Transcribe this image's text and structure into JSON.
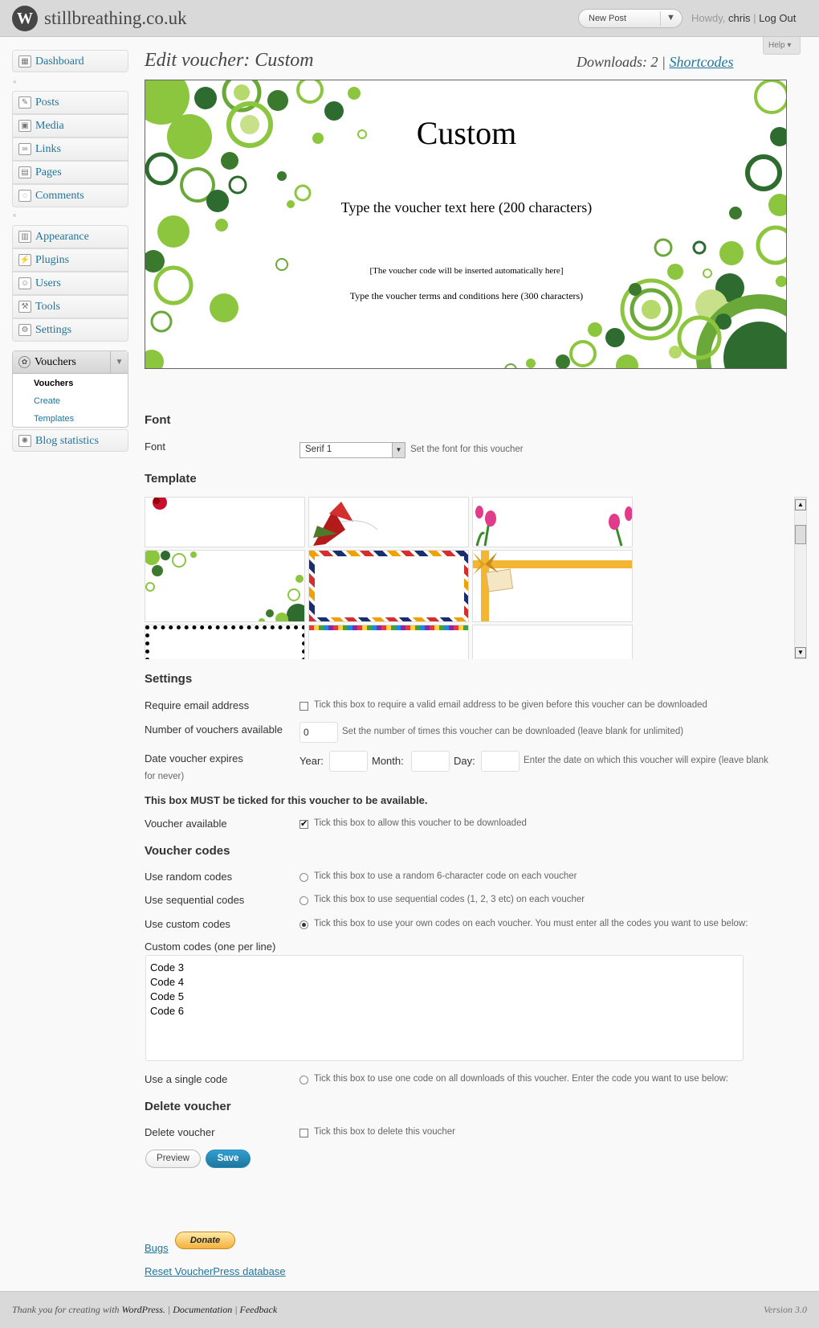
{
  "header": {
    "site_name": "stillbreathing.co.uk",
    "new_post": "New Post",
    "howdy": "Howdy,",
    "user": "chris",
    "logout": "Log Out",
    "help": "Help"
  },
  "sidebar": {
    "items": [
      {
        "label": "Dashboard",
        "icon": "dashboard-icon"
      },
      {
        "label": "Posts",
        "icon": "pin-icon"
      },
      {
        "label": "Media",
        "icon": "media-icon"
      },
      {
        "label": "Links",
        "icon": "link-icon"
      },
      {
        "label": "Pages",
        "icon": "page-icon"
      },
      {
        "label": "Comments",
        "icon": "comment-icon"
      },
      {
        "label": "Appearance",
        "icon": "appearance-icon"
      },
      {
        "label": "Plugins",
        "icon": "plugin-icon"
      },
      {
        "label": "Users",
        "icon": "users-icon"
      },
      {
        "label": "Tools",
        "icon": "tools-icon"
      },
      {
        "label": "Settings",
        "icon": "settings-icon"
      }
    ],
    "vouchers": {
      "label": "Vouchers",
      "sub": [
        "Vouchers",
        "Create",
        "Templates"
      ]
    },
    "blog_stats": "Blog statistics"
  },
  "main": {
    "title": "Edit voucher: Custom",
    "downloads_label": "Downloads:",
    "downloads_count": "2",
    "shortcodes": "Shortcodes",
    "preview": {
      "title": "Custom",
      "text": "Type the voucher text here (200 characters)",
      "code": "[The voucher code will be inserted automatically here]",
      "terms": "Type the voucher terms and conditions here (300 characters)"
    },
    "font_section": "Font",
    "font_label": "Font",
    "font_value": "Serif 1",
    "font_desc": "Set the font for this voucher",
    "template_section": "Template",
    "settings_section": "Settings",
    "require_email_label": "Require email address",
    "require_email_desc": "Tick this box to require a valid email address to be given before this voucher can be downloaded",
    "num_vouchers_label": "Number of vouchers available",
    "num_vouchers_value": "0",
    "num_vouchers_desc": "Set the number of times this voucher can be downloaded (leave blank for unlimited)",
    "expires_label": "Date voucher expires",
    "year_label": "Year:",
    "month_label": "Month:",
    "day_label": "Day:",
    "expires_desc_1": "Enter the date on which this voucher will expire (leave blank",
    "expires_desc_2": "for never)",
    "must_tick": "This box MUST be ticked for this voucher to be available.",
    "available_label": "Voucher available",
    "available_desc": "Tick this box to allow this voucher to be downloaded",
    "codes_section": "Voucher codes",
    "random_label": "Use random codes",
    "random_desc": "Tick this box to use a random 6-character code on each voucher",
    "sequential_label": "Use sequential codes",
    "sequential_desc": "Tick this box to use sequential codes (1, 2, 3 etc) on each voucher",
    "custom_label": "Use custom codes",
    "custom_desc": "Tick this box to use your own codes on each voucher. You must enter all the codes you want to use below:",
    "custom_codes_label": "Custom codes (one per line)",
    "custom_codes": [
      "Code 3",
      "Code 4",
      "Code 5",
      "Code 6"
    ],
    "single_label": "Use a single code",
    "single_desc": "Tick this box to use one code on all downloads of this voucher. Enter the code you want to use below:",
    "delete_section": "Delete voucher",
    "delete_label": "Delete voucher",
    "delete_desc": "Tick this box to delete this voucher",
    "preview_button": "Preview",
    "save_button": "Save",
    "bugs": "Bugs",
    "donate": "Donate",
    "reset": "Reset VoucherPress database"
  },
  "footer": {
    "thanks": "Thank you for creating with",
    "wordpress": "WordPress.",
    "documentation": "Documentation",
    "feedback": "Feedback",
    "version": "Version 3.0"
  },
  "colors": {
    "link": "#21759b",
    "header_bg": "#d9d9d9",
    "accent_green": "#8cc63f",
    "dark_green": "#2e6b2e"
  }
}
